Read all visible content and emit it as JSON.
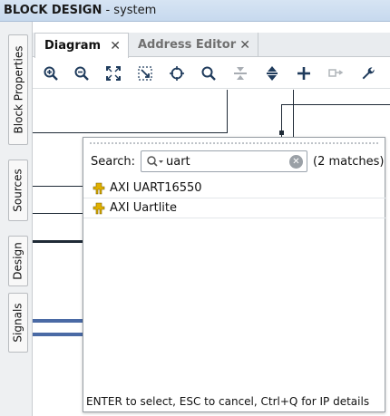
{
  "title": {
    "bold": "BLOCK DESIGN",
    "rest": " - system"
  },
  "side_tabs": [
    {
      "label": "Block Properties"
    },
    {
      "label": "Sources"
    },
    {
      "label": "Design"
    },
    {
      "label": "Signals"
    }
  ],
  "tabs": [
    {
      "label": "Diagram",
      "active": true
    },
    {
      "label": "Address Editor",
      "active": false
    }
  ],
  "toolbar": {
    "buttons": [
      "zoom-in-icon",
      "zoom-out-icon",
      "fit-full-icon",
      "zoom-fit-selection-icon",
      "locate-icon",
      "search-icon",
      "collapse-icon",
      "expand-collapse-icon",
      "add-ip-icon",
      "connect-icon",
      "wrench-icon"
    ]
  },
  "popup": {
    "search_label": "Search:",
    "search_value": "uart",
    "match_count": "(2 matches)",
    "results": [
      {
        "label": "AXI UART16550"
      },
      {
        "label": "AXI Uartlite"
      }
    ],
    "footer": "ENTER to select, ESC to cancel, Ctrl+Q for IP details"
  },
  "colors": {
    "accent": "#4a6aa5",
    "ip_icon": "#e0b000"
  }
}
